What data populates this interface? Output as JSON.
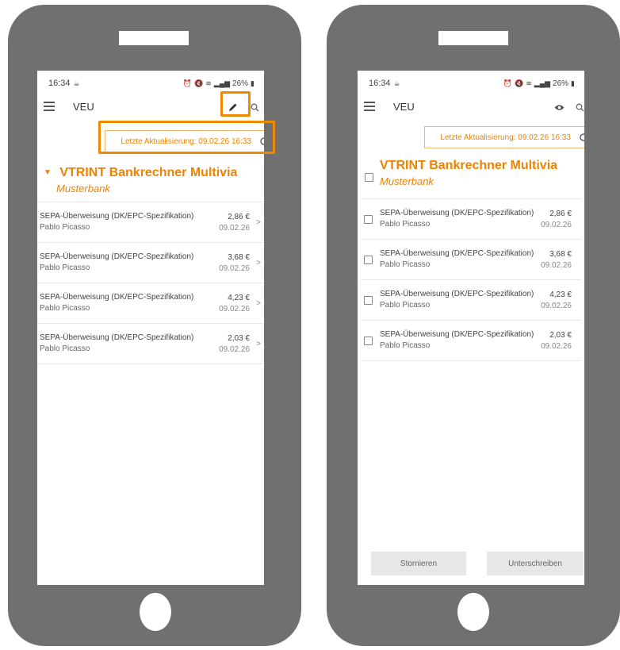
{
  "colors": {
    "accent": "#EE8200",
    "highlight": "#F08A00",
    "phone_body": "#707070"
  },
  "status_bar": {
    "time": "16:34",
    "battery": "26%"
  },
  "app": {
    "title": "VEU"
  },
  "update": {
    "text": "Letzte Aktualisierung: 09.02.26 16:33"
  },
  "bank": {
    "name": "VTRINT Bankrechner Multivia",
    "subtitle": "Musterbank"
  },
  "transactions": [
    {
      "title": "SEPA-Überweisung (DK/EPC-Spezifikation)",
      "name": "Pablo Picasso",
      "amount": "2,86 €",
      "date": "09.02.26"
    },
    {
      "title": "SEPA-Überweisung (DK/EPC-Spezifikation)",
      "name": "Pablo Picasso",
      "amount": "3,68 €",
      "date": "09.02.26"
    },
    {
      "title": "SEPA-Überweisung (DK/EPC-Spezifikation)",
      "name": "Pablo Picasso",
      "amount": "4,23 €",
      "date": "09.02.26"
    },
    {
      "title": "SEPA-Überweisung (DK/EPC-Spezifikation)",
      "name": "Pablo Picasso",
      "amount": "2,03 €",
      "date": "09.02.26"
    }
  ],
  "actions": {
    "cancel_label": "Stornieren",
    "sign_label": "Unterschreiben"
  },
  "icons": [
    "hamburger-menu-icon",
    "pencil-icon",
    "search-icon",
    "eye-icon",
    "refresh-icon",
    "chevron-right-icon",
    "caret-down-icon",
    "checkbox-icon"
  ]
}
